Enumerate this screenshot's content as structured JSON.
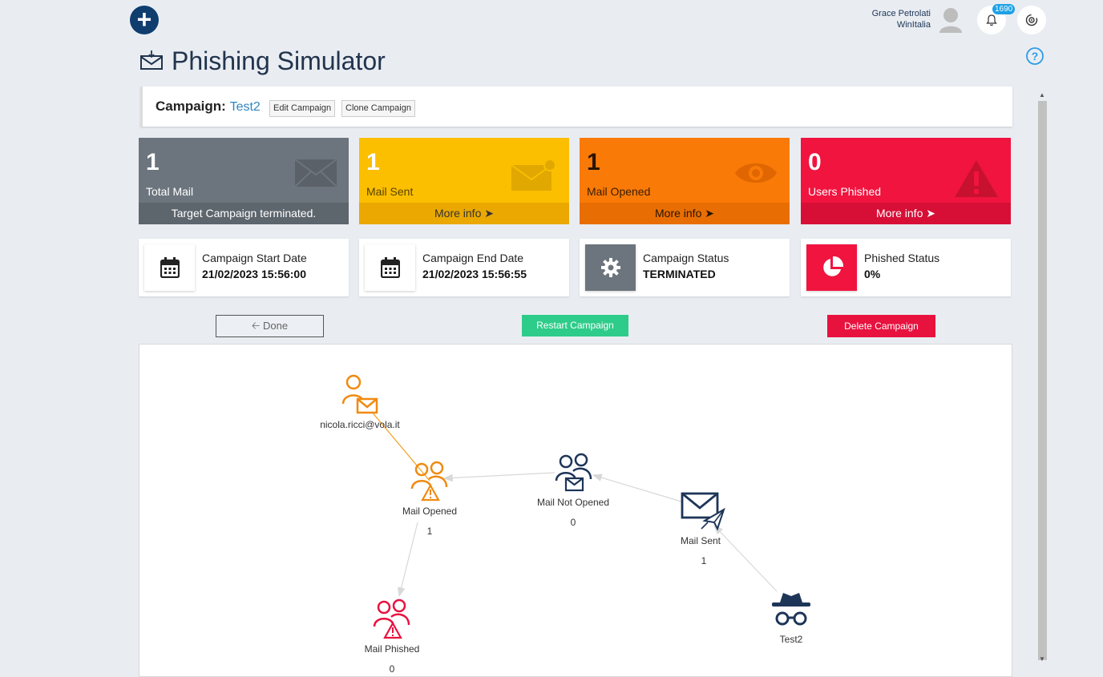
{
  "header": {
    "user_name": "Grace Petrolati",
    "user_org": "WinItalia",
    "notification_count": "1690"
  },
  "page": {
    "title": "Phishing Simulator"
  },
  "campaign": {
    "label": "Campaign:",
    "name": "Test2",
    "edit_label": "Edit Campaign",
    "clone_label": "Clone Campaign"
  },
  "stats": [
    {
      "value": "1",
      "label": "Total Mail",
      "footer": "Target Campaign terminated.",
      "color": "#6c757d",
      "footer_color": "#5d656d"
    },
    {
      "value": "1",
      "label": "Mail Sent",
      "footer": "More info",
      "color": "#fbbf00",
      "footer_color": "#eaa800"
    },
    {
      "value": "1",
      "label": "Mail Opened",
      "footer": "More info",
      "color": "#f97a07",
      "footer_color": "#e86e03"
    },
    {
      "value": "0",
      "label": "Users Phished",
      "footer": "More info",
      "color": "#f0143f",
      "footer_color": "#d70f37"
    }
  ],
  "info": [
    {
      "label": "Campaign Start Date",
      "value": "21/02/2023 15:56:00"
    },
    {
      "label": "Campaign End Date",
      "value": "21/02/2023 15:56:55"
    },
    {
      "label": "Campaign Status",
      "value": "TERMINATED"
    },
    {
      "label": "Phished Status",
      "value": "0%"
    }
  ],
  "actions": {
    "done_label": "Done",
    "restart_label": "Restart Campaign",
    "delete_label": "Delete Campaign"
  },
  "graph": {
    "nodes": [
      {
        "label": "nicola.ricci@vola.it",
        "count": ""
      },
      {
        "label": "Mail Opened",
        "count": "1"
      },
      {
        "label": "Mail Not Opened",
        "count": "0"
      },
      {
        "label": "Mail Sent",
        "count": "1"
      },
      {
        "label": "Test2",
        "count": ""
      },
      {
        "label": "Mail Phished",
        "count": "0"
      }
    ]
  },
  "colors": {
    "orange": "#f08a10",
    "navy": "#1d3557",
    "red": "#e8123f"
  }
}
